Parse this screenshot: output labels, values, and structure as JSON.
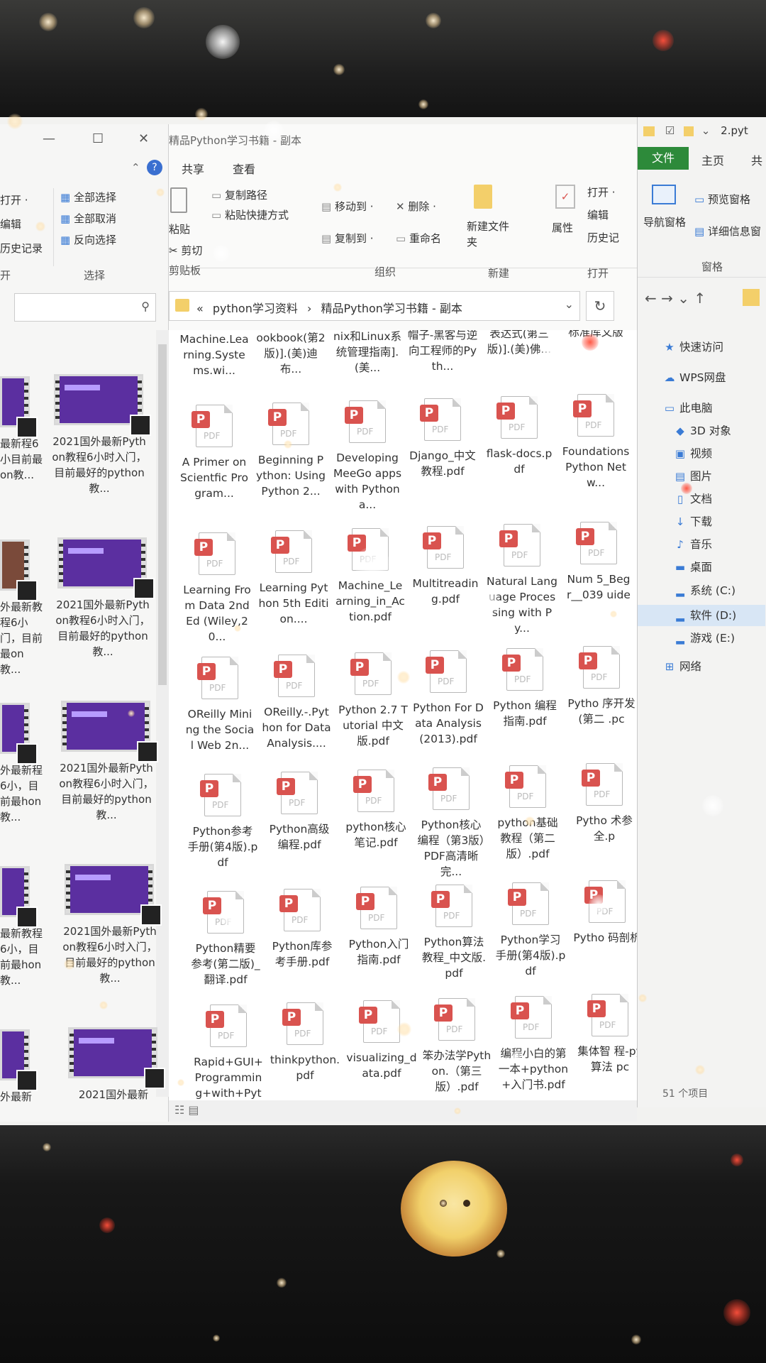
{
  "left_window": {
    "ribbon": {
      "open_label": "打开 ·",
      "edit_label": "编辑",
      "history_label": "历史记录",
      "select_all": "全部选择",
      "select_none": "全部取消",
      "invert_select": "反向选择",
      "group_open": "开",
      "group_select": "选择"
    },
    "thumbs": [
      {
        "caption": "2021国外最新Python教程6小时入门，目前最好的python教..."
      },
      {
        "caption": "2021国外最新Python教程6小时入门，目前最好的python教..."
      },
      {
        "caption": "2021国外最新Python教程6小时入门，目前最好的python教..."
      },
      {
        "caption": "2021国外最新Python教程6小时入门，目前最好的python教..."
      },
      {
        "caption": "2021国外最新"
      }
    ],
    "partials": [
      {
        "caption": "最新程6小目前最on教..."
      },
      {
        "caption": "外最新教程6小门，目前最on教..."
      },
      {
        "caption": "外最新程6小，目前最hon教..."
      },
      {
        "caption": "最新教程6小，目前最hon教..."
      },
      {
        "caption": "外最新"
      }
    ]
  },
  "middle_window": {
    "title": "精品Python学习书籍 - 副本",
    "tabs": [
      "共享",
      "查看"
    ],
    "ribbon": {
      "paste": "粘贴",
      "cut": "剪切",
      "copy_path": "复制路径",
      "paste_shortcut": "粘贴快捷方式",
      "move_to": "移动到 ·",
      "copy_to": "复制到 ·",
      "delete": "删除 ·",
      "rename": "重命名",
      "new_folder": "新建文件夹",
      "properties": "属性",
      "open": "打开 ·",
      "edit": "编辑",
      "history": "历史记",
      "group_clipboard": "剪贴板",
      "group_organize": "组织",
      "group_new": "新建",
      "group_open": "打开"
    },
    "address": {
      "prefix": "«",
      "crumb1": "python学习资料",
      "sep": "›",
      "crumb2": "精品Python学习书籍 - 副本",
      "dropdown": "⌄",
      "refresh": "↻"
    },
    "top_partial_names": [
      "Machine.Learning.Systems.wi...",
      "ookbook(第2版)].(美)迪布...",
      "nix和Linux系统管理指南].(美...",
      "帽子-黑客与逆向工程师的Pyth...",
      "表达式(第三版)].(美)佛...",
      "标准库文版"
    ],
    "files": [
      [
        "A Primer on Scientfic Program...",
        "Beginning Python: Using Python 2...",
        "Developing MeeGo apps with Python a...",
        "Django_中文教程.pdf",
        "flask-docs.pdf",
        "Foundations Python Netw..."
      ],
      [
        "Learning From Data 2nd Ed (Wiley,20...",
        "Learning Python 5th Edition....",
        "Machine_Learning_in_Action.pdf",
        "Multitreading.pdf",
        "Natural Language Processing with Py...",
        "Num 5_Beg r__039 uide"
      ],
      [
        "OReilly Mining the Social Web 2n...",
        "OReilly.-.Python for Data Analysis....",
        "Python 2.7 Tutorial 中文版.pdf",
        "Python For Data Analysis (2013).pdf",
        "Python 编程指南.pdf",
        "Pytho 序开发 (第二 .pc"
      ],
      [
        "Python参考手册(第4版).pdf",
        "Python高级编程.pdf",
        "python核心笔记.pdf",
        "Python核心编程（第3版）PDF高清晰完...",
        "python基础教程（第二版）.pdf",
        "Pytho 术参 全.p"
      ],
      [
        "Python精要参考(第二版)_翻译.pdf",
        "Python库参考手册.pdf",
        "Python入门指南.pdf",
        "Python算法教程_中文版.pdf",
        "Python学习手册(第4版).pdf",
        "Pytho 码剖析"
      ],
      [
        "Rapid+GUI+Programming+with+Pytho...",
        "thinkpython.pdf",
        "visualizing_data.pdf",
        "笨办法学Python.（第三版）.pdf",
        "编程小白的第一本+python+入门书.pdf",
        "集体智 程-py 算法 pc"
      ]
    ],
    "pdf_label": "PDF",
    "pdf_badge": "P"
  },
  "right_window": {
    "qat_title": "2.pyt",
    "tab_file": "文件",
    "tab_home": "主页",
    "tab_share": "共",
    "nav_pane": "导航窗格",
    "preview_pane": "预览窗格",
    "details_pane": "详细信息窗",
    "group_panes": "窗格",
    "nav_arrows": "←  →  ⌄  ↑",
    "tree": [
      {
        "icon": "star-icon",
        "glyph": "★",
        "label": "快速访问"
      },
      {
        "icon": "cloud-icon",
        "glyph": "☁",
        "label": "WPS网盘"
      },
      {
        "icon": "computer-icon",
        "glyph": "▭",
        "label": "此电脑"
      },
      {
        "icon": "cube-icon",
        "glyph": "◆",
        "label": "3D 对象"
      },
      {
        "icon": "video-icon",
        "glyph": "▣",
        "label": "视频"
      },
      {
        "icon": "picture-icon",
        "glyph": "▤",
        "label": "图片"
      },
      {
        "icon": "document-icon",
        "glyph": "▯",
        "label": "文档"
      },
      {
        "icon": "download-icon",
        "glyph": "↓",
        "label": "下载"
      },
      {
        "icon": "music-icon",
        "glyph": "♪",
        "label": "音乐"
      },
      {
        "icon": "desktop-icon",
        "glyph": "▬",
        "label": "桌面"
      },
      {
        "icon": "drive-c-icon",
        "glyph": "▂",
        "label": "系统 (C:)"
      },
      {
        "icon": "drive-d-icon",
        "glyph": "▂",
        "label": "软件 (D:)"
      },
      {
        "icon": "drive-e-icon",
        "glyph": "▂",
        "label": "游戏 (E:)"
      },
      {
        "icon": "network-icon",
        "glyph": "⊞",
        "label": "网络"
      }
    ],
    "status": "51 个项目"
  }
}
